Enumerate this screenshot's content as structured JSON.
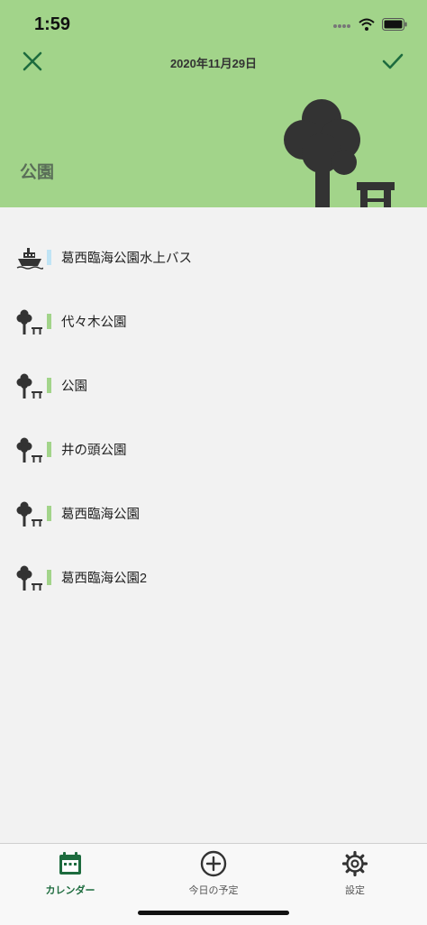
{
  "status_bar": {
    "time": "1:59"
  },
  "nav": {
    "title": "2020年11月29日",
    "close_icon": "close-icon",
    "done_icon": "checkmark-icon"
  },
  "category": {
    "title": "公園",
    "illustration": "tree-bench-icon"
  },
  "colors": {
    "header_bg": "#a2d48a",
    "accent": "#1d6b3e",
    "park": "#a2d48a",
    "boat": "#bfe4f5"
  },
  "places": [
    {
      "label": "葛西臨海公園水上バス",
      "icon": "boat-icon",
      "color": "#bfe4f5"
    },
    {
      "label": "代々木公園",
      "icon": "tree-bench-icon",
      "color": "#a2d48a"
    },
    {
      "label": "公園",
      "icon": "tree-bench-icon",
      "color": "#a2d48a"
    },
    {
      "label": "井の頭公園",
      "icon": "tree-bench-icon",
      "color": "#a2d48a"
    },
    {
      "label": "葛西臨海公園",
      "icon": "tree-bench-icon",
      "color": "#a2d48a"
    },
    {
      "label": "葛西臨海公園2",
      "icon": "tree-bench-icon",
      "color": "#a2d48a"
    }
  ],
  "tabs": [
    {
      "label": "カレンダー",
      "icon": "calendar-icon",
      "active": true
    },
    {
      "label": "今日の予定",
      "icon": "plus-circle-icon",
      "active": false
    },
    {
      "label": "設定",
      "icon": "gear-icon",
      "active": false
    }
  ]
}
